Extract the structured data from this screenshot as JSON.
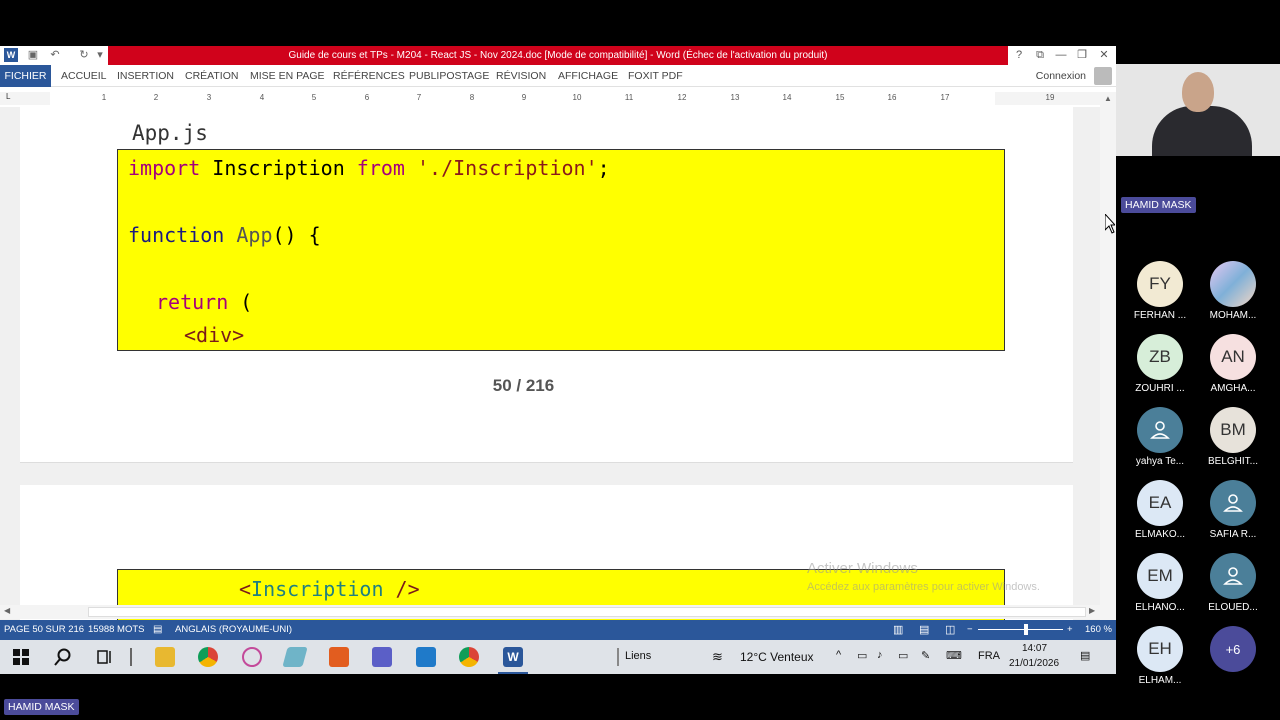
{
  "word": {
    "title": "Guide de cours et TPs - M204 -  React JS - Nov 2024.doc [Mode de compatibilité] -  Word (Échec de l'activation du produit)",
    "tabs": [
      "FICHIER",
      "ACCUEIL",
      "INSERTION",
      "CRÉATION",
      "MISE EN PAGE",
      "RÉFÉRENCES",
      "PUBLIPOSTAGE",
      "RÉVISION",
      "AFFICHAGE",
      "FOXIT PDF"
    ],
    "connexion": "Connexion",
    "ruler_numbers": [
      "1",
      "2",
      "3",
      "4",
      "5",
      "6",
      "7",
      "8",
      "9",
      "10",
      "11",
      "12",
      "13",
      "14",
      "15",
      "16",
      "17",
      "19"
    ],
    "ruler_corner": "L",
    "document": {
      "file_title": "App.js",
      "code_top": {
        "line1": {
          "kw": "import",
          "mid1": " Inscription ",
          "kw2": "from",
          "str": " './Inscription'",
          "end": ";"
        },
        "line2": {
          "kw": "function",
          "fn": " App",
          "end": "() {"
        },
        "line3": {
          "kw": "return",
          "end": " ("
        },
        "line4": "<div>"
      },
      "page_number": "50 / 216",
      "code_bottom": {
        "open": "<",
        "comp": "Inscription",
        "close": " />"
      }
    },
    "activate": {
      "title": "Activer Windows",
      "subtitle": "Accédez aux paramètres pour activer Windows."
    },
    "status": {
      "page": "PAGE 50 SUR 216",
      "words": "15988 MOTS",
      "language": "ANGLAIS (ROYAUME-UNI)",
      "zoom": "160 %"
    },
    "taskbar": {
      "links": "Liens",
      "weather": "12°C  Venteux",
      "lang": "FRA",
      "time": "14:07",
      "date": "21/01/2026"
    }
  },
  "meeting": {
    "presenter": "HAMID MASK",
    "bottom_tag": "HAMID MASK",
    "participants": [
      {
        "initials": "FY",
        "name": "FERHAN ...",
        "color": "beige"
      },
      {
        "initials": "",
        "name": "MOHAM...",
        "color": "photo"
      },
      {
        "initials": "ZB",
        "name": "ZOUHRI ...",
        "color": "green"
      },
      {
        "initials": "AN",
        "name": "AMGHA...",
        "color": "pink"
      },
      {
        "initials": "",
        "name": "yahya Te...",
        "color": "teal"
      },
      {
        "initials": "BM",
        "name": "BELGHIT...",
        "color": "gray"
      },
      {
        "initials": "EA",
        "name": "ELMAKO...",
        "color": "blue"
      },
      {
        "initials": "",
        "name": "SAFIA R...",
        "color": "teal"
      },
      {
        "initials": "EM",
        "name": "ELHANO...",
        "color": "blue"
      },
      {
        "initials": "",
        "name": "ELOUED...",
        "color": "teal"
      },
      {
        "initials": "EH",
        "name": "ELHAM...",
        "color": "blue"
      },
      {
        "initials": "+6",
        "name": "",
        "color": "more"
      }
    ]
  }
}
